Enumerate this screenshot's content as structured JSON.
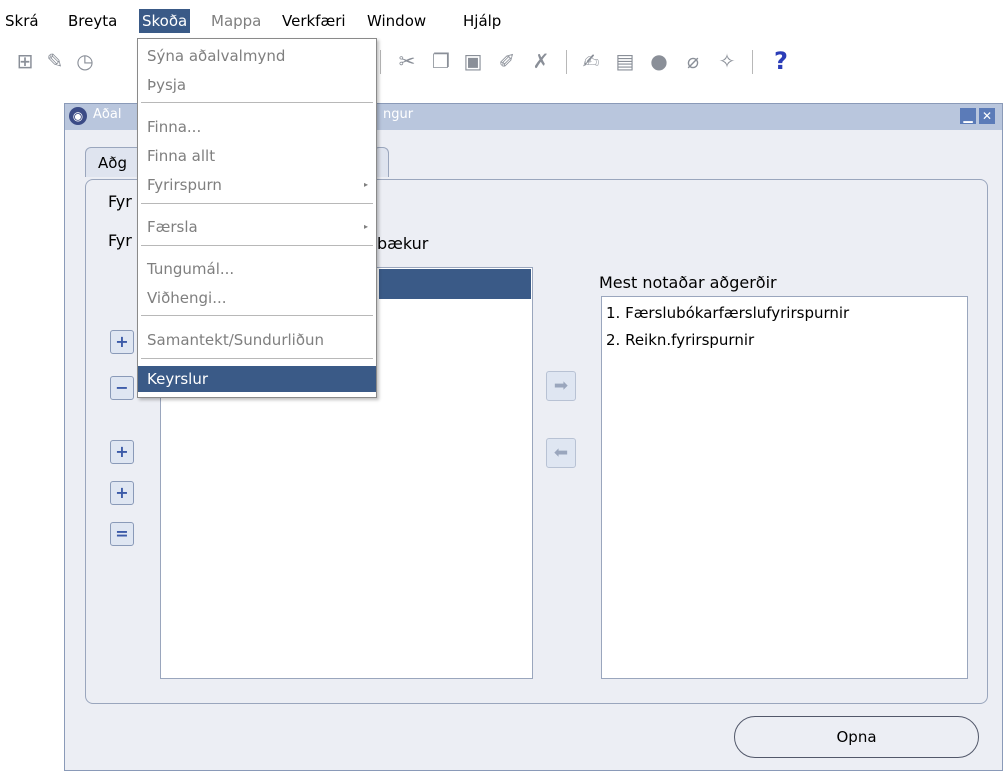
{
  "menubar": {
    "items": [
      {
        "label": "Skrá"
      },
      {
        "label": "Breyta"
      },
      {
        "label": "Skoða"
      },
      {
        "label": "Mappa"
      },
      {
        "label": "Verkfæri"
      },
      {
        "label": "Window"
      },
      {
        "label": "Hjálp"
      }
    ]
  },
  "toolbar": {
    "help_label": "?"
  },
  "view_menu": {
    "items": [
      {
        "label": "Sýna aðalvalmynd"
      },
      {
        "label": "Þysja"
      },
      {
        "label": "Finna..."
      },
      {
        "label": "Finna allt"
      },
      {
        "label": "Fyrirspurn",
        "submenu_glyph": "▸"
      },
      {
        "label": "Færsla",
        "submenu_glyph": "▸"
      },
      {
        "label": "Tungumál..."
      },
      {
        "label": "Viðhengi..."
      },
      {
        "label": "Samantekt/Sundurliðun"
      },
      {
        "label": "Keyrslur"
      }
    ]
  },
  "window": {
    "title_start": "Aðal",
    "title_end": "ngur",
    "minimize_glyph": "▁",
    "close_glyph": "✕",
    "tab_label": "Aðg",
    "label_1": "Fyr",
    "label_2": "Fyr",
    "label_2_end": "bækur",
    "most_used_heading": "Mest notaðar aðgerðir",
    "most_used_items": [
      {
        "label": "1. Færslubókarfærslufyrirspurnir"
      },
      {
        "label": "2. Reikn.fyrirspurnir"
      }
    ],
    "open_button": "Opna"
  },
  "colors": {
    "highlight": "#3a5a87",
    "titlebar": "#b9c6dd",
    "window_bg": "#eceef4"
  }
}
